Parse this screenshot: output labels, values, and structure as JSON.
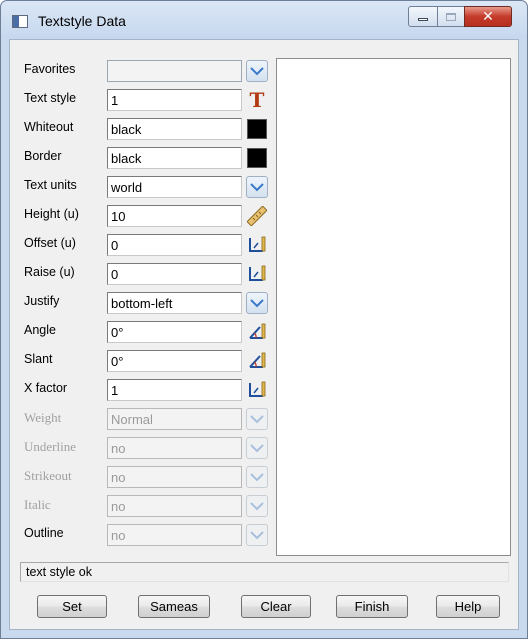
{
  "window": {
    "title": "Textstyle Data"
  },
  "icons": {
    "app": "window-app-icon",
    "minimize": "minimize-icon",
    "maximize": "maximize-icon",
    "close": "close-icon",
    "dropdown": "chevron-down-icon",
    "textstyle": "text-style-T-icon",
    "color": "color-swatch",
    "ruler": "ruler-icon",
    "pick": "pick-point-icon",
    "angle": "angle-pick-icon"
  },
  "colors": {
    "accent_dropdown": "#3a78c8",
    "text_style_icon": "#b23a12",
    "swatch": "#000000"
  },
  "form": {
    "favorites": {
      "label": "Favorites",
      "value": ""
    },
    "text_style": {
      "label": "Text style",
      "value": "1"
    },
    "whiteout": {
      "label": "Whiteout",
      "value": "black"
    },
    "border": {
      "label": "Border",
      "value": "black"
    },
    "text_units": {
      "label": "Text units",
      "value": "world"
    },
    "height": {
      "label": "Height (u)",
      "value": "10"
    },
    "offset": {
      "label": "Offset (u)",
      "value": "0"
    },
    "raise": {
      "label": "Raise (u)",
      "value": "0"
    },
    "justify": {
      "label": "Justify",
      "value": "bottom-left"
    },
    "angle": {
      "label": "Angle",
      "value": "0°"
    },
    "slant": {
      "label": "Slant",
      "value": "0°"
    },
    "x_factor": {
      "label": "X factor",
      "value": "1"
    },
    "weight": {
      "label": "Weight",
      "value": "Normal"
    },
    "underline": {
      "label": "Underline",
      "value": "no"
    },
    "strikeout": {
      "label": "Strikeout",
      "value": "no"
    },
    "italic": {
      "label": "Italic",
      "value": "no"
    },
    "outline": {
      "label": "Outline",
      "value": "no"
    }
  },
  "status": "text style ok",
  "buttons": {
    "set": "Set",
    "sameas": "Sameas",
    "clear": "Clear",
    "finish": "Finish",
    "help": "Help"
  }
}
